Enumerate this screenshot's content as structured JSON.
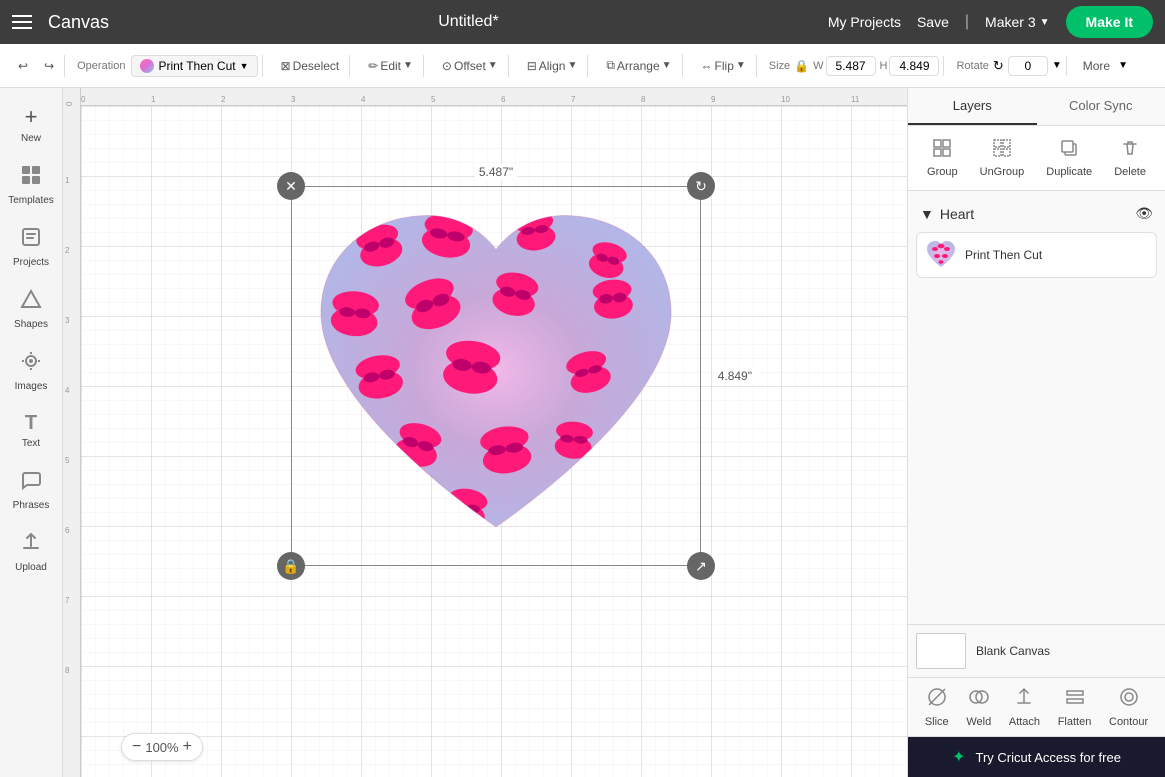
{
  "header": {
    "hamburger_label": "Menu",
    "app_name": "Canvas",
    "title": "Untitled*",
    "my_projects": "My Projects",
    "save": "Save",
    "divider": "|",
    "machine": "Maker 3",
    "make_it": "Make It"
  },
  "toolbar": {
    "undo_label": "Undo",
    "redo_label": "Redo",
    "operation_label": "Operation",
    "operation_value": "Print Then Cut",
    "deselect_label": "Deselect",
    "edit_label": "Edit",
    "offset_label": "Offset",
    "align_label": "Align",
    "arrange_label": "Arrange",
    "flip_label": "Flip",
    "size_label": "Size",
    "width_label": "W",
    "width_value": "5.487",
    "height_label": "H",
    "height_value": "4.849",
    "rotate_label": "Rotate",
    "rotate_value": "0",
    "more_label": "More"
  },
  "sidebar": {
    "items": [
      {
        "id": "new",
        "label": "New",
        "icon": "+"
      },
      {
        "id": "templates",
        "label": "Templates",
        "icon": "⊞"
      },
      {
        "id": "projects",
        "label": "Projects",
        "icon": "◻"
      },
      {
        "id": "shapes",
        "label": "Shapes",
        "icon": "△"
      },
      {
        "id": "images",
        "label": "Images",
        "icon": "✿"
      },
      {
        "id": "text",
        "label": "Text",
        "icon": "T"
      },
      {
        "id": "phrases",
        "label": "Phrases",
        "icon": "💬"
      },
      {
        "id": "upload",
        "label": "Upload",
        "icon": "↑"
      }
    ]
  },
  "right_panel": {
    "tabs": [
      {
        "id": "layers",
        "label": "Layers",
        "active": true
      },
      {
        "id": "color_sync",
        "label": "Color Sync",
        "active": false
      }
    ],
    "actions": [
      {
        "id": "group",
        "label": "Group",
        "icon": "⊞",
        "disabled": false
      },
      {
        "id": "ungroup",
        "label": "UnGroup",
        "icon": "⊟",
        "disabled": false
      },
      {
        "id": "duplicate",
        "label": "Duplicate",
        "icon": "⧉",
        "disabled": false
      },
      {
        "id": "delete",
        "label": "Delete",
        "icon": "🗑",
        "disabled": false
      }
    ],
    "layer_group": {
      "name": "Heart",
      "expanded": true,
      "items": [
        {
          "id": "layer1",
          "label": "Print Then Cut",
          "type": "print_then_cut"
        }
      ]
    },
    "blank_canvas": {
      "label": "Blank Canvas"
    },
    "bottom_tools": [
      {
        "id": "slice",
        "label": "Slice",
        "icon": "⊘"
      },
      {
        "id": "weld",
        "label": "Weld",
        "icon": "⊕"
      },
      {
        "id": "attach",
        "label": "Attach",
        "icon": "📎"
      },
      {
        "id": "flatten",
        "label": "Flatten",
        "icon": "▥"
      },
      {
        "id": "contour",
        "label": "Contour",
        "icon": "◯"
      }
    ],
    "cricut_access": {
      "text": "Try Cricut Access for free",
      "icon": "✦"
    }
  },
  "canvas": {
    "zoom_value": "100%",
    "dimension_top": "5.487\"",
    "dimension_right": "4.849\""
  },
  "rulers": {
    "top": [
      "0",
      "1",
      "2",
      "3",
      "4",
      "5",
      "6",
      "7",
      "8",
      "9",
      "10",
      "11"
    ],
    "left": [
      "0",
      "1",
      "2",
      "3",
      "4",
      "5",
      "6",
      "7",
      "8"
    ]
  }
}
